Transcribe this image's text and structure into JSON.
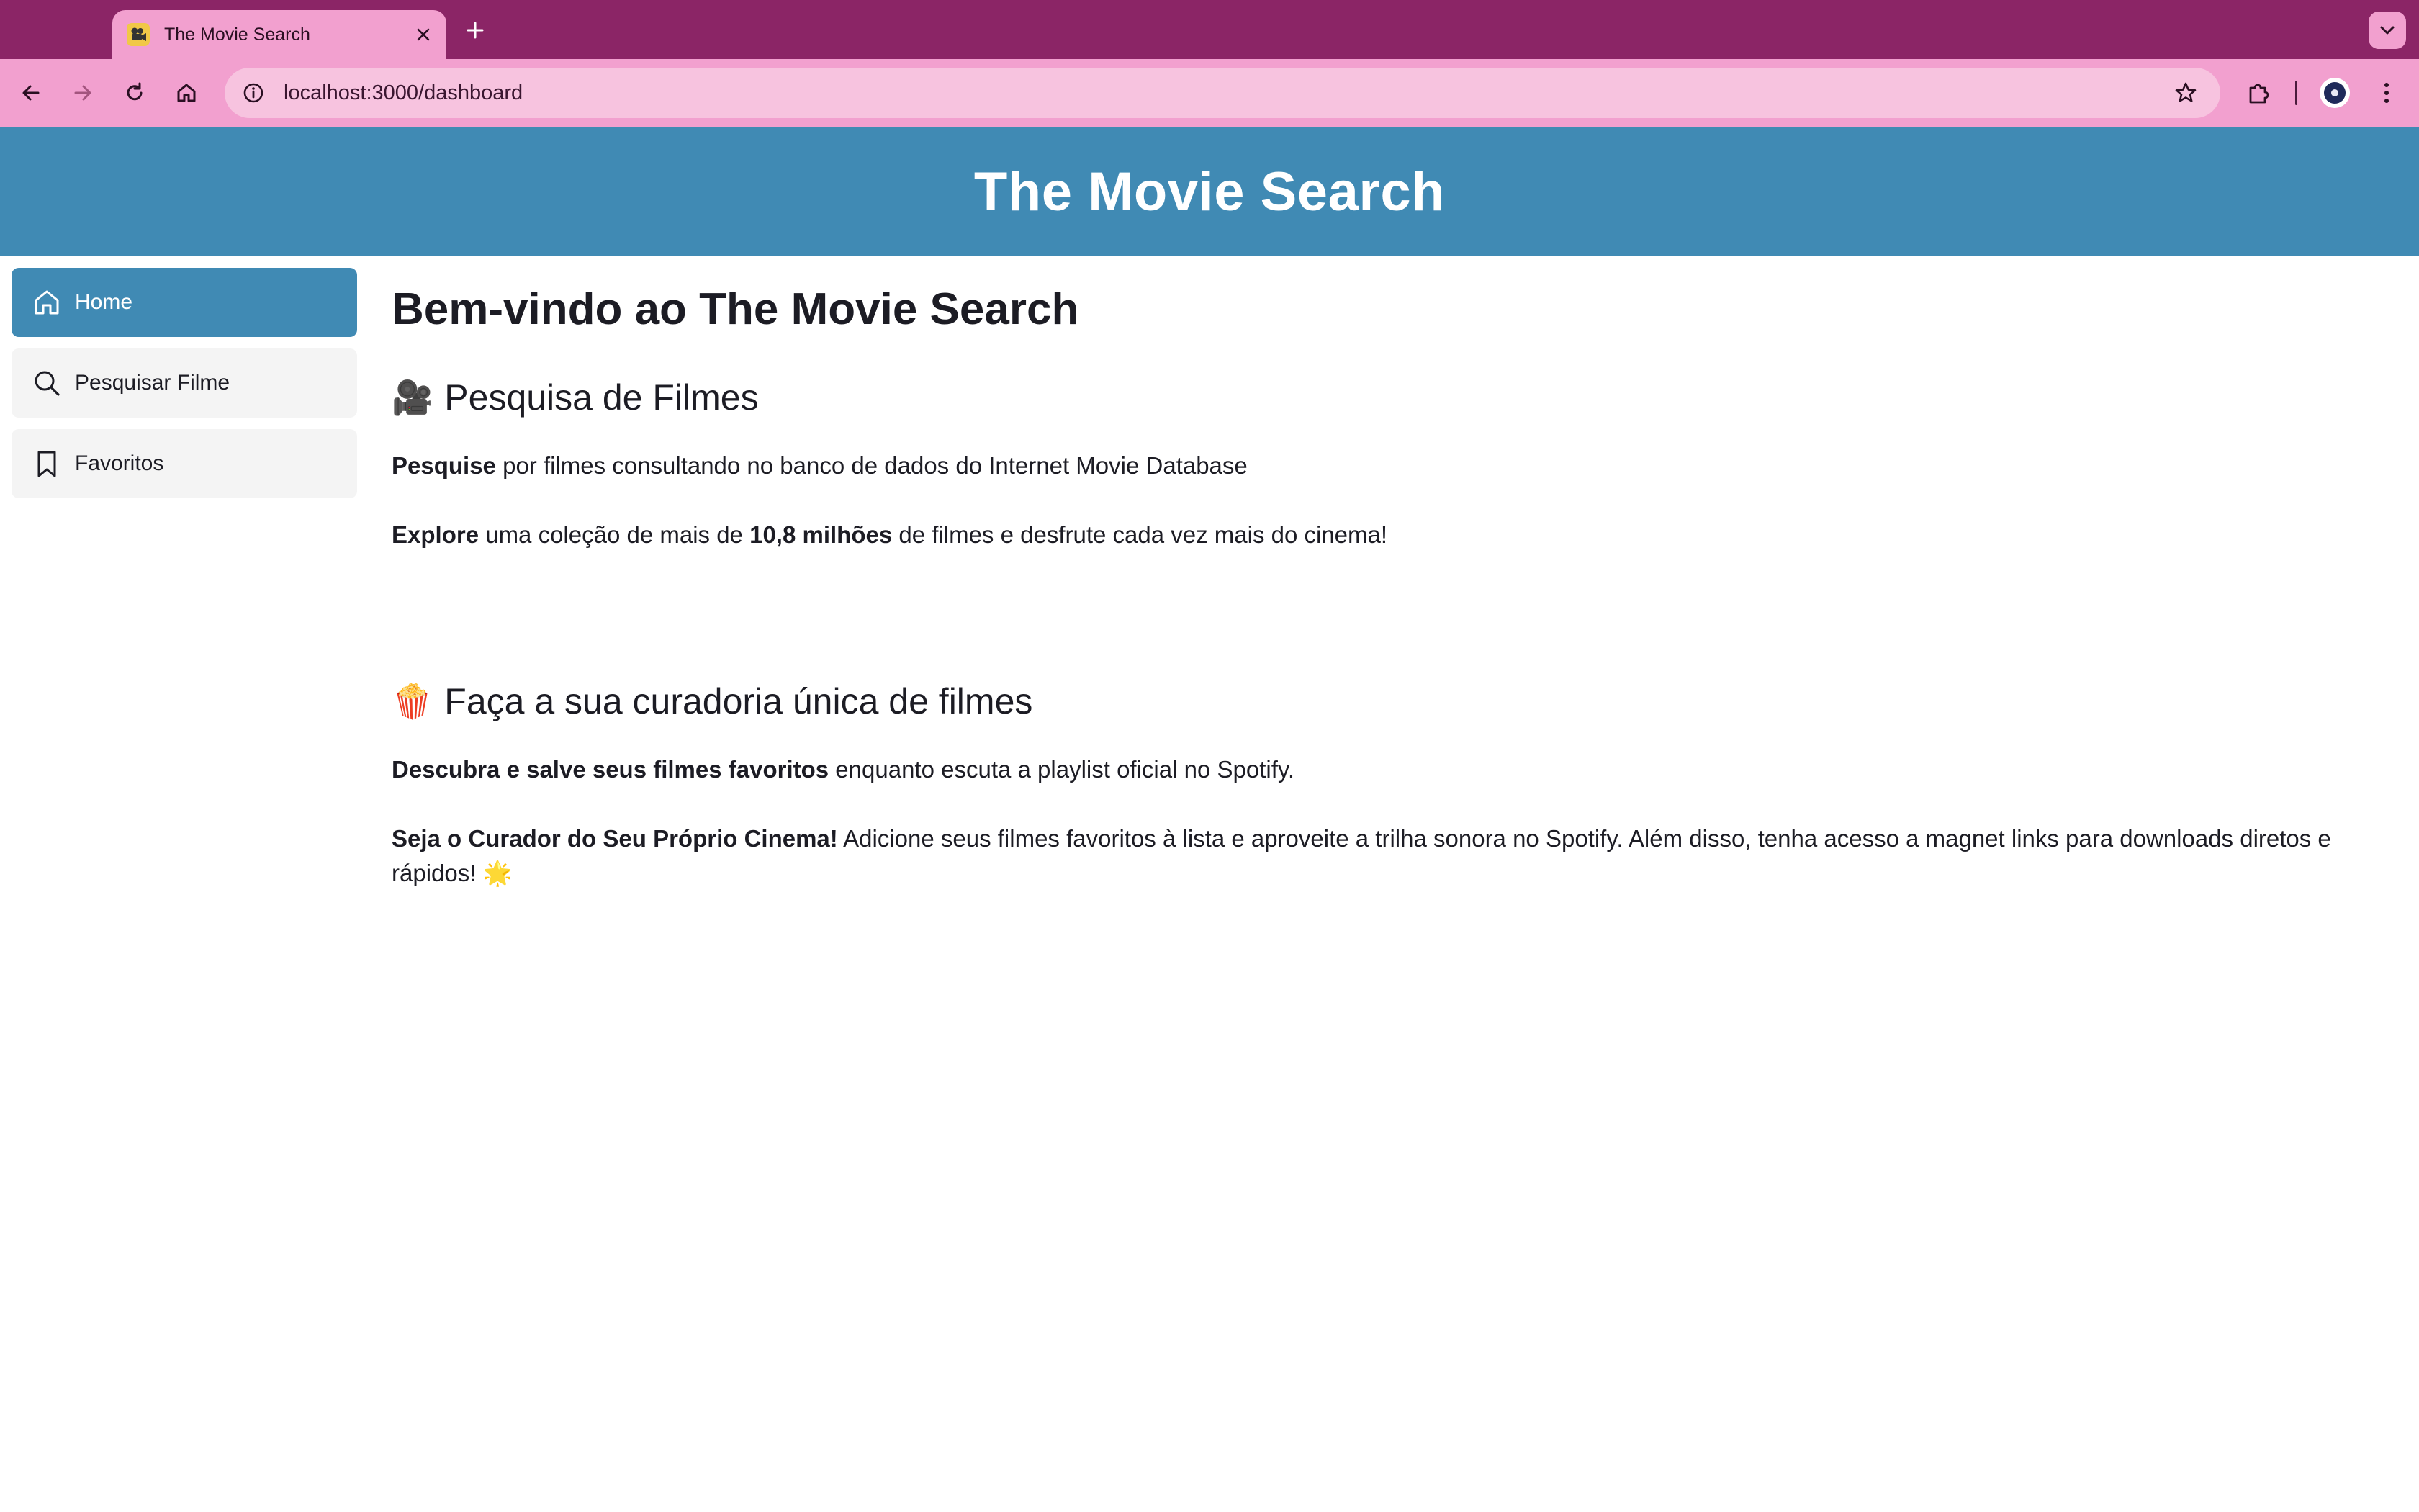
{
  "browser": {
    "tab_title": "The Movie Search",
    "url": "localhost:3000/dashboard"
  },
  "header": {
    "title": "The Movie Search"
  },
  "sidebar": {
    "items": [
      {
        "label": "Home",
        "icon": "home-icon",
        "active": true
      },
      {
        "label": "Pesquisar Filme",
        "icon": "search-icon",
        "active": false
      },
      {
        "label": "Favoritos",
        "icon": "bookmark-icon",
        "active": false
      }
    ]
  },
  "main": {
    "heading": "Bem-vindo ao The Movie Search",
    "section1": {
      "emoji": "🎥",
      "title": "Pesquisa de Filmes",
      "p1_bold": "Pesquise",
      "p1_text": " por filmes consultando no banco de dados do Internet Movie Database",
      "p2_bold": "Explore",
      "p2_text_a": " uma coleção de mais de ",
      "p2_bold2": "10,8 milhões",
      "p2_text_b": " de filmes e desfrute cada vez mais do cinema!"
    },
    "section2": {
      "emoji": "🍿",
      "title": "Faça a sua curadoria única de filmes",
      "p1_bold": "Descubra e salve seus filmes favoritos",
      "p1_text": " enquanto escuta a playlist oficial no Spotify.",
      "p2_bold": "Seja o Curador do Seu Próprio Cinema!",
      "p2_text": " Adicione seus filmes favoritos à lista e aproveite a trilha sonora no Spotify. Além disso, tenha acesso a magnet links para downloads diretos e rápidos! ",
      "p2_emoji": "🌟"
    }
  },
  "colors": {
    "tabstrip": "#8b2566",
    "toolbar": "#f2a0cf",
    "header": "#408ab4",
    "active_nav": "#408ab4"
  }
}
